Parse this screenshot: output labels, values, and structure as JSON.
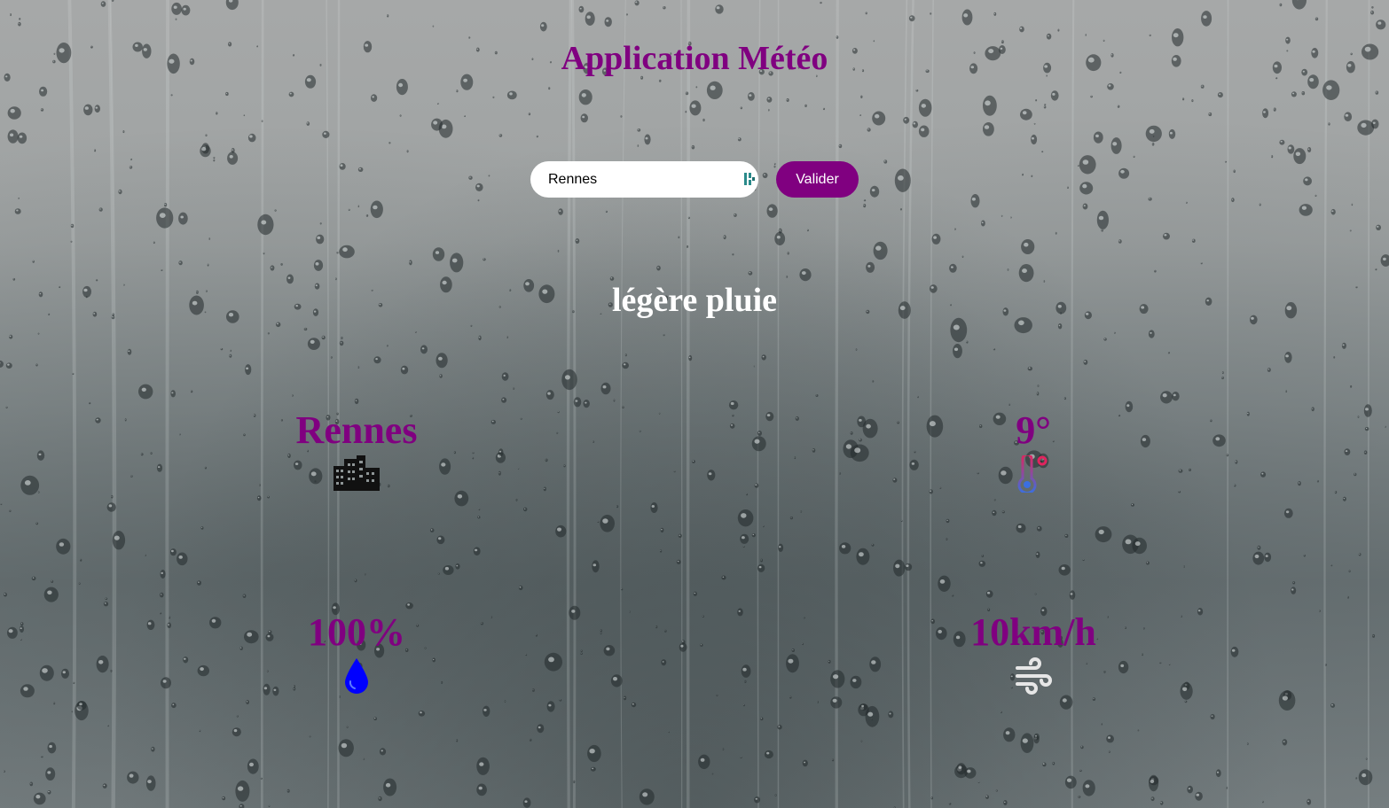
{
  "app": {
    "title": "Application Météo"
  },
  "search": {
    "value": "Rennes",
    "button_label": "Valider"
  },
  "weather": {
    "description": "légère pluie",
    "city": "Rennes",
    "temperature": "9°",
    "humidity": "100%",
    "wind": "10km/h"
  },
  "icons": {
    "city": "city-buildings-icon",
    "temperature": "thermometer-icon",
    "humidity": "water-drop-icon",
    "wind": "wind-icon",
    "extension": "password-manager-extension-icon"
  },
  "colors": {
    "accent": "#800080",
    "description_text": "#ffffff",
    "humidity_icon": "#0000ff",
    "thermometer_hot": "#e0245e",
    "thermometer_cold": "#3b6fe0",
    "wind_icon": "#e6e6e6"
  }
}
